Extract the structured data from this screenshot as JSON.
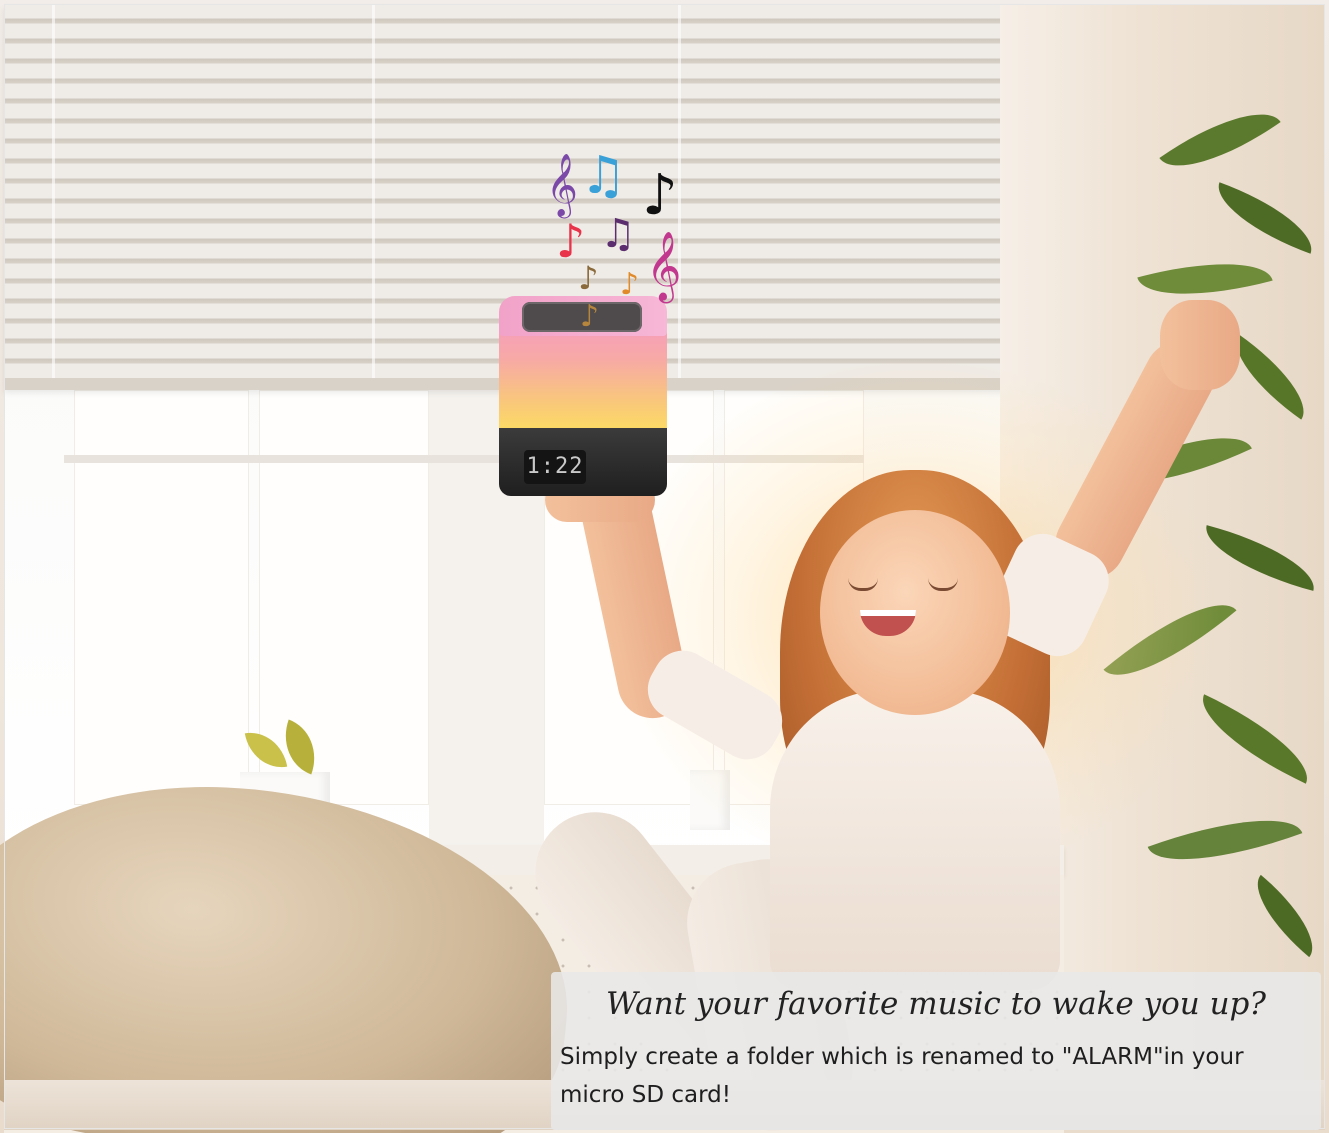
{
  "caption": {
    "headline": "Want your favorite music to wake you up?",
    "body": "Simply create a folder which is renamed to \"ALARM\"in your micro SD card!"
  },
  "lamp": {
    "clock_display": "1:22"
  },
  "music_notes": {
    "glyphs": [
      "𝄞",
      "♫",
      "♪",
      "♪",
      "♫",
      "𝄞",
      "♪",
      "♪",
      "♪"
    ],
    "colors": [
      "#7b4aa8",
      "#3aa0d8",
      "#111111",
      "#e8334a",
      "#5b2d6e",
      "#c2388f",
      "#8a6a3a",
      "#e08a2a",
      "#b5863c"
    ]
  },
  "colors": {
    "lamp_gradient_top": "#f79cc2",
    "lamp_gradient_bottom": "#fde05e",
    "lamp_base": "#1f1f1f",
    "caption_background": "#e8e8e8"
  }
}
